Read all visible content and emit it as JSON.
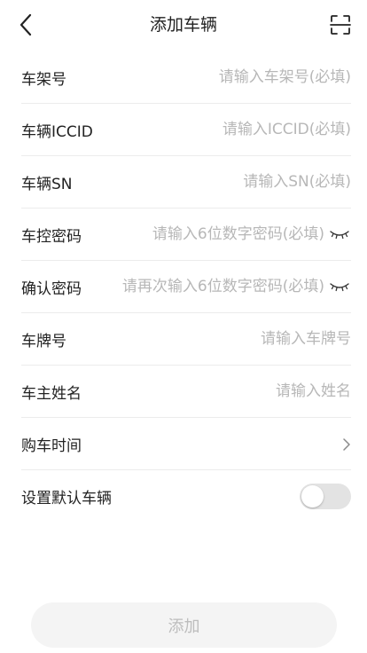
{
  "header": {
    "title": "添加车辆"
  },
  "form": {
    "frame_number": {
      "label": "车架号",
      "placeholder": "请输入车架号(必填)"
    },
    "iccid": {
      "label": "车辆ICCID",
      "placeholder": "请输入ICCID(必填)"
    },
    "sn": {
      "label": "车辆SN",
      "placeholder": "请输入SN(必填)"
    },
    "control_password": {
      "label": "车控密码",
      "placeholder": "请输入6位数字密码(必填)"
    },
    "confirm_password": {
      "label": "确认密码",
      "placeholder": "请再次输入6位数字密码(必填)"
    },
    "plate_number": {
      "label": "车牌号",
      "placeholder": "请输入车牌号"
    },
    "owner_name": {
      "label": "车主姓名",
      "placeholder": "请输入姓名"
    },
    "purchase_time": {
      "label": "购车时间"
    },
    "default_vehicle": {
      "label": "设置默认车辆",
      "enabled": false
    }
  },
  "submit": {
    "label": "添加"
  },
  "colors": {
    "text": "#222222",
    "placeholder": "#b7b7b7",
    "divider": "#ececec",
    "toggle_off": "#e3e3e3",
    "button_bg": "#f4f4f4",
    "button_text": "#bdbdbd"
  },
  "icons": {
    "back": "chevron-left-icon",
    "scan": "scan-icon",
    "password_visibility": "eye-closed-icon",
    "purchase_time_arrow": "chevron-right-icon"
  }
}
